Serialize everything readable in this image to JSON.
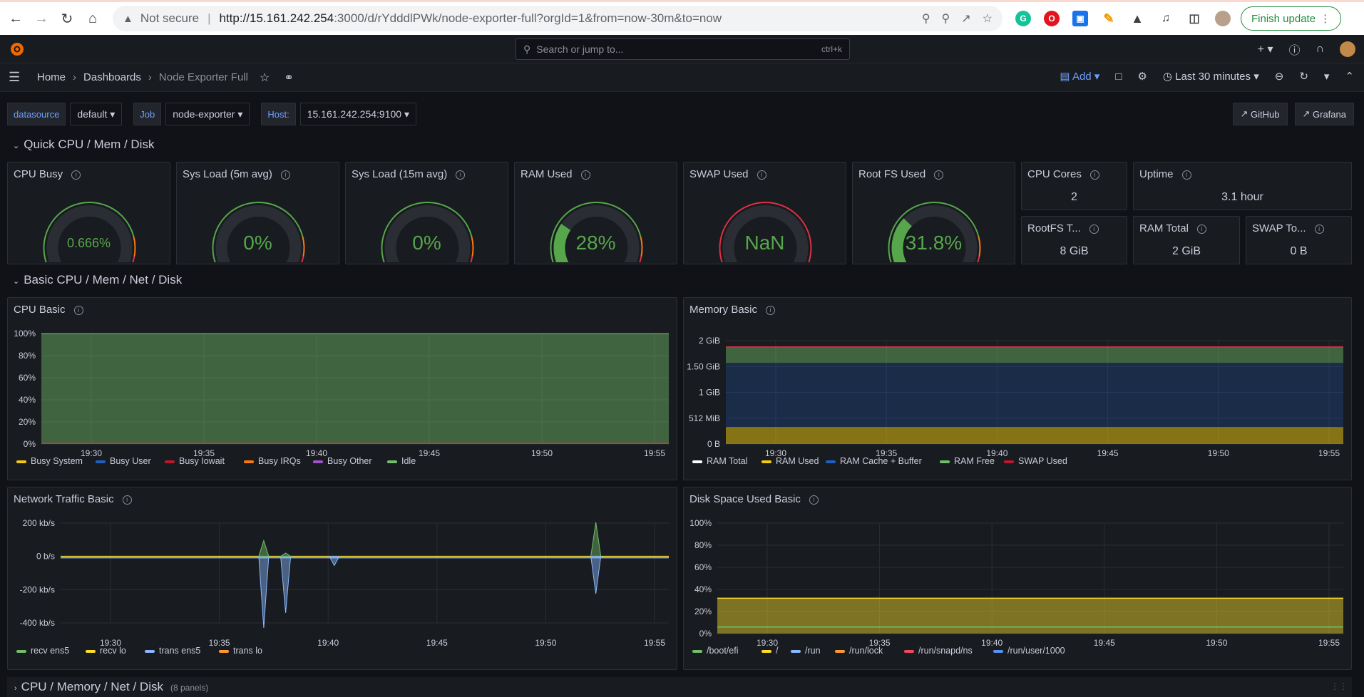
{
  "browser": {
    "not_secure": "Not secure",
    "url_host": "http://15.161.242.254",
    "url_rest": ":3000/d/rYdddlPWk/node-exporter-full?orgId=1&from=now-30m&to=now",
    "finish_update": "Finish update"
  },
  "topbar": {
    "search_placeholder": "Search or jump to...",
    "search_shortcut": "ctrl+k"
  },
  "breadcrumb": {
    "home": "Home",
    "dashboards": "Dashboards",
    "current": "Node Exporter Full",
    "add_label": "Add",
    "time_range": "Last 30 minutes"
  },
  "variables": [
    {
      "label": "datasource",
      "value": "default"
    },
    {
      "label": "Job",
      "value": "node-exporter"
    },
    {
      "label": "Host:",
      "value": "15.161.242.254:9100"
    }
  ],
  "links": {
    "github": "GitHub",
    "grafana": "Grafana"
  },
  "rows": {
    "quick": "Quick CPU / Mem / Disk",
    "basic": "Basic CPU / Mem / Net / Disk",
    "full": "CPU / Memory / Net / Disk",
    "full_count": "(8 panels)"
  },
  "gauges": [
    {
      "title": "CPU Busy",
      "value": "0.666%",
      "fraction": 0.00666
    },
    {
      "title": "Sys Load (5m avg)",
      "value": "0%",
      "fraction": 0
    },
    {
      "title": "Sys Load (15m avg)",
      "value": "0%",
      "fraction": 0
    },
    {
      "title": "RAM Used",
      "value": "28%",
      "fraction": 0.28
    },
    {
      "title": "SWAP Used",
      "value": "NaN",
      "fraction": null
    },
    {
      "title": "Root FS Used",
      "value": "31.8%",
      "fraction": 0.318
    }
  ],
  "stats": [
    {
      "title": "CPU Cores",
      "value": "2"
    },
    {
      "title": "Uptime",
      "value": "3.1 hour"
    },
    {
      "title": "RootFS T...",
      "value": "8 GiB"
    },
    {
      "title": "RAM Total",
      "value": "2 GiB"
    },
    {
      "title": "SWAP To...",
      "value": "0 B"
    }
  ],
  "colors": {
    "green": "#56a64b",
    "yellow": "#f2cc0c",
    "red": "#e02f44",
    "orange": "#ff780a",
    "blue": "#8ab8ff",
    "purple": "#a352cc",
    "accent": "#6e9fff"
  },
  "chart_data": [
    {
      "title": "CPU Basic",
      "type": "area",
      "y_ticks": [
        "100%",
        "80%",
        "60%",
        "40%",
        "20%",
        "0%"
      ],
      "x_ticks": [
        "19:30",
        "19:35",
        "19:40",
        "19:45",
        "19:50",
        "19:55"
      ],
      "ylim": [
        0,
        100
      ],
      "series": [
        {
          "name": "Busy System",
          "color": "#f2cc0c",
          "value": 0.3
        },
        {
          "name": "Busy User",
          "color": "#1f60c4",
          "value": 0.3
        },
        {
          "name": "Busy Iowait",
          "color": "#c4162a",
          "value": 0
        },
        {
          "name": "Busy IRQs",
          "color": "#ff780a",
          "value": 0
        },
        {
          "name": "Busy Other",
          "color": "#a352cc",
          "value": 0
        },
        {
          "name": "Idle",
          "color": "#73bf69",
          "value": 99.3
        }
      ]
    },
    {
      "title": "Memory Basic",
      "type": "area",
      "y_ticks": [
        "2 GiB",
        "1.50 GiB",
        "1 GiB",
        "512 MiB",
        "0 B"
      ],
      "x_ticks": [
        "19:30",
        "19:35",
        "19:40",
        "19:45",
        "19:50",
        "19:55"
      ],
      "ylim": [
        0,
        2
      ],
      "series": [
        {
          "name": "RAM Total",
          "color": "#ffffff",
          "value": 1.88
        },
        {
          "name": "RAM Used",
          "color": "#f2cc0c",
          "value": 0.33
        },
        {
          "name": "RAM Cache + Buffer",
          "color": "#1f60c4",
          "value": 1.24
        },
        {
          "name": "RAM Free",
          "color": "#73bf69",
          "value": 0.31
        },
        {
          "name": "SWAP Used",
          "color": "#c4162a",
          "value": 0
        }
      ]
    },
    {
      "title": "Network Traffic Basic",
      "type": "area",
      "y_ticks": [
        "200 kb/s",
        "0 b/s",
        "-200 kb/s",
        "-400 kb/s"
      ],
      "x_ticks": [
        "19:30",
        "19:35",
        "19:40",
        "19:45",
        "19:50",
        "19:55"
      ],
      "series": [
        {
          "name": "recv ens5",
          "color": "#73bf69"
        },
        {
          "name": "recv lo",
          "color": "#fade2a"
        },
        {
          "name": "trans ens5",
          "color": "#8ab8ff"
        },
        {
          "name": "trans lo",
          "color": "#ff9830"
        }
      ]
    },
    {
      "title": "Disk Space Used Basic",
      "type": "area",
      "y_ticks": [
        "100%",
        "80%",
        "60%",
        "40%",
        "20%",
        "0%"
      ],
      "x_ticks": [
        "19:30",
        "19:35",
        "19:40",
        "19:45",
        "19:50",
        "19:55"
      ],
      "ylim": [
        0,
        100
      ],
      "series": [
        {
          "name": "/boot/efi",
          "color": "#73bf69",
          "value": 6
        },
        {
          "name": "/",
          "color": "#fade2a",
          "value": 32
        },
        {
          "name": "/run",
          "color": "#8ab8ff",
          "value": 0.1
        },
        {
          "name": "/run/lock",
          "color": "#ff9830",
          "value": 0
        },
        {
          "name": "/run/snapd/ns",
          "color": "#f2495c",
          "value": 0.1
        },
        {
          "name": "/run/user/1000",
          "color": "#5794f2",
          "value": 0
        }
      ]
    }
  ]
}
